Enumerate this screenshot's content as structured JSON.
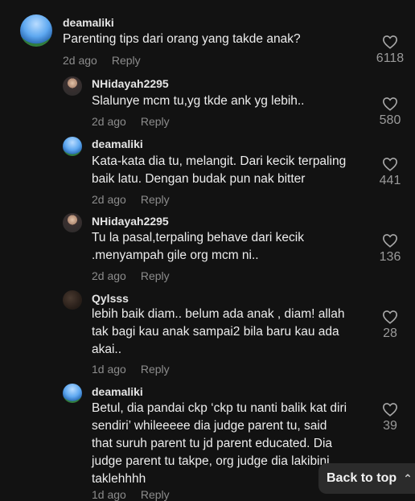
{
  "comments": [
    {
      "username": "deamaliki",
      "text": "Parenting tips dari orang yang takde anak?",
      "time": "2d ago",
      "reply_label": "Reply",
      "likes": "6118",
      "avatar": "sky-landscape"
    },
    {
      "username": "NHidayah2295",
      "text": "Slalunye mcm tu,yg tkde ank yg lebih..",
      "time": "2d ago",
      "reply_label": "Reply",
      "likes": "580",
      "avatar": "person-photo"
    },
    {
      "username": "deamaliki",
      "text": "Kata-kata dia tu, melangit. Dari kecik terpaling\nbaik latu. Dengan budak pun nak bitter",
      "time": "2d ago",
      "reply_label": "Reply",
      "likes": "441",
      "avatar": "sky-landscape"
    },
    {
      "username": "NHidayah2295",
      "text": "Tu la pasal,terpaling behave dari kecik\n.menyampah gile org mcm ni..",
      "time": "2d ago",
      "reply_label": "Reply",
      "likes": "136",
      "avatar": "person-photo"
    },
    {
      "username": "Qylsss",
      "text": "lebih baik diam.. belum ada anak , diam! allah\ntak bagi kau anak sampai2 bila baru kau ada\nakai..",
      "time": "1d ago",
      "reply_label": "Reply",
      "likes": "28",
      "avatar": "dark-photo"
    },
    {
      "username": "deamaliki",
      "text": "Betul, dia pandai ckp ‘ckp tu nanti balik kat diri\nsendiri’ whileeeee dia judge parent tu, said\nthat suruh parent tu jd parent educated. Dia\njudge parent tu takpe, org judge dia lakibini\ntaklehhhh",
      "time": "1d ago",
      "reply_label": "Reply",
      "likes": "39",
      "avatar": "sky-landscape"
    }
  ],
  "back_to_top": {
    "label": "Back to top",
    "icon": "double-chevron-up-icon"
  },
  "colors": {
    "background": "#121212",
    "text": "#ededed",
    "muted": "#8c8c8c"
  }
}
